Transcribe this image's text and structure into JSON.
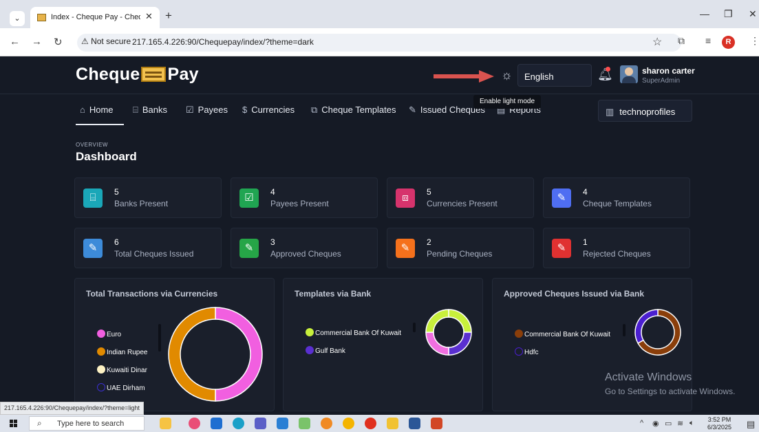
{
  "browser": {
    "tab_title": "Index - Cheque Pay - Cheque P",
    "security_label": "Not secure",
    "url": "217.165.4.226:90/Chequepay/index/?theme=dark",
    "profile_initial": "R",
    "status_url": "217.165.4.226:90/Chequepay/index/?theme=light"
  },
  "header": {
    "logo_left": "Cheque",
    "logo_right": "Pay",
    "language": "English",
    "user_name": "sharon carter",
    "user_role": "SuperAdmin",
    "tooltip": "Enable light mode"
  },
  "nav": {
    "items": [
      "Home",
      "Banks",
      "Payees",
      "Currencies",
      "Cheque Templates",
      "Issued Cheques",
      "Reports"
    ],
    "workspace": "technoprofiles"
  },
  "dashboard": {
    "overline": "OVERVIEW",
    "title": "Dashboard",
    "cards": [
      {
        "value": "5",
        "label": "Banks Present",
        "color": "#1aa7b8",
        "icon": "bank-icon"
      },
      {
        "value": "4",
        "label": "Payees Present",
        "color": "#20a552",
        "icon": "check-square-icon"
      },
      {
        "value": "5",
        "label": "Currencies Present",
        "color": "#d6336c",
        "icon": "currency-icon"
      },
      {
        "value": "4",
        "label": "Cheque Templates",
        "color": "#4f6ef2",
        "icon": "pen-icon"
      },
      {
        "value": "6",
        "label": "Total Cheques Issued",
        "color": "#3d8bd9",
        "icon": "pen-icon"
      },
      {
        "value": "3",
        "label": "Approved Cheques",
        "color": "#26a547",
        "icon": "pen-icon"
      },
      {
        "value": "2",
        "label": "Pending Cheques",
        "color": "#f5711c",
        "icon": "pen-icon"
      },
      {
        "value": "1",
        "label": "Rejected Cheques",
        "color": "#e03131",
        "icon": "pen-icon"
      }
    ]
  },
  "chart_data": [
    {
      "type": "pie",
      "title": "Total Transactions via Currencies",
      "categories": [
        "Euro",
        "Indian Rupee",
        "Kuwaiti Dinar",
        "UAE Dirham"
      ],
      "values": [
        50,
        50,
        0,
        0
      ],
      "colors": [
        "#f15fe0",
        "#e18a00",
        "#fdf2c4",
        "#3b2fd0"
      ],
      "legend": "left"
    },
    {
      "type": "pie",
      "title": "Templates via Bank",
      "categories": [
        "Commercial Bank Of Kuwait",
        "Gulf Bank"
      ],
      "values": [
        25,
        25,
        25,
        25
      ],
      "colors": [
        "#c8f03c",
        "#5a2fd0",
        "#f06fe0",
        "#c8f03c"
      ],
      "legend": "left"
    },
    {
      "type": "pie",
      "title": "Approved Cheques Issued via Bank",
      "categories": [
        "Commercial Bank Of Kuwait",
        "Hdfc"
      ],
      "values": [
        67,
        33
      ],
      "colors": [
        "#8a3e0a",
        "#4b1fd0"
      ],
      "legend": "left"
    }
  ],
  "watermark": {
    "line1": "Activate Windows",
    "line2": "Go to Settings to activate Windows."
  },
  "taskbar": {
    "search_placeholder": "Type here to search",
    "time": "3:52 PM",
    "date": "6/3/2025"
  }
}
